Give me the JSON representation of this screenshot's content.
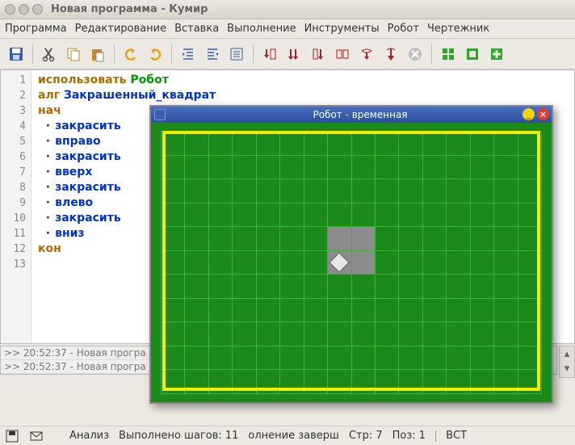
{
  "title": "Новая программа - Кумир",
  "menu": {
    "program": "Программа",
    "edit": "Редактирование",
    "insert": "Вставка",
    "run": "Выполнение",
    "tools": "Инструменты",
    "robot": "Робот",
    "drawer": "Чертежник"
  },
  "toolbar_icons": {
    "save": "save-icon",
    "cut": "cut-icon",
    "copy": "copy-icon",
    "paste": "paste-icon",
    "undo": "undo-icon",
    "redo": "redo-icon",
    "indent": "indent-icon",
    "outdent": "outdent-icon",
    "toggle-comment": "toggle-comment-icon",
    "step-into": "step-into-icon",
    "step-over": "step-over-icon",
    "run": "run-icon",
    "debug": "debug-icon",
    "run2": "run2-icon",
    "run3": "run3-icon",
    "stop": "stop-icon",
    "grid1": "grid-icon",
    "grid2": "grid-outline-icon",
    "grid3": "grid-plus-icon"
  },
  "code": {
    "lines": [
      {
        "n": 1,
        "t": "keyword",
        "text": "использовать",
        "actor": "Робот"
      },
      {
        "n": 2,
        "t": "alg",
        "alg": "алг",
        "name": "Закрашенный_квадрат"
      },
      {
        "n": 3,
        "t": "plain",
        "kw": "нач"
      },
      {
        "n": 4,
        "t": "cmd",
        "cmd": "закрасить"
      },
      {
        "n": 5,
        "t": "cmd",
        "cmd": "вправо"
      },
      {
        "n": 6,
        "t": "cmd",
        "cmd": "закрасить"
      },
      {
        "n": 7,
        "t": "cmd",
        "cmd": "вверх"
      },
      {
        "n": 8,
        "t": "cmd",
        "cmd": "закрасить"
      },
      {
        "n": 9,
        "t": "cmd",
        "cmd": "влево"
      },
      {
        "n": 10,
        "t": "cmd",
        "cmd": "закрасить"
      },
      {
        "n": 11,
        "t": "cmd",
        "cmd": "вниз"
      },
      {
        "n": 12,
        "t": "plain",
        "kw": "кон"
      },
      {
        "n": 13,
        "t": "empty"
      }
    ]
  },
  "log": {
    "rows": [
      ">> 20:52:37 - Новая програ",
      ">> 20:52:37 - Новая програ"
    ]
  },
  "status": {
    "analysis": "Анализ",
    "steps": "Выполнено шагов: 11",
    "done": "олнение заверш",
    "line": "Стр: 7",
    "pos": "Поз: 1",
    "mode": "ВСТ"
  },
  "robot_window": {
    "title": "Робот - временная",
    "min_label": "_",
    "close_label": "×",
    "grid": {
      "cols": 16,
      "rows": 11
    },
    "painted": [
      [
        7,
        4
      ],
      [
        8,
        4
      ],
      [
        7,
        5
      ],
      [
        8,
        5
      ]
    ],
    "robot_pos": {
      "col": 7,
      "row": 5
    }
  }
}
